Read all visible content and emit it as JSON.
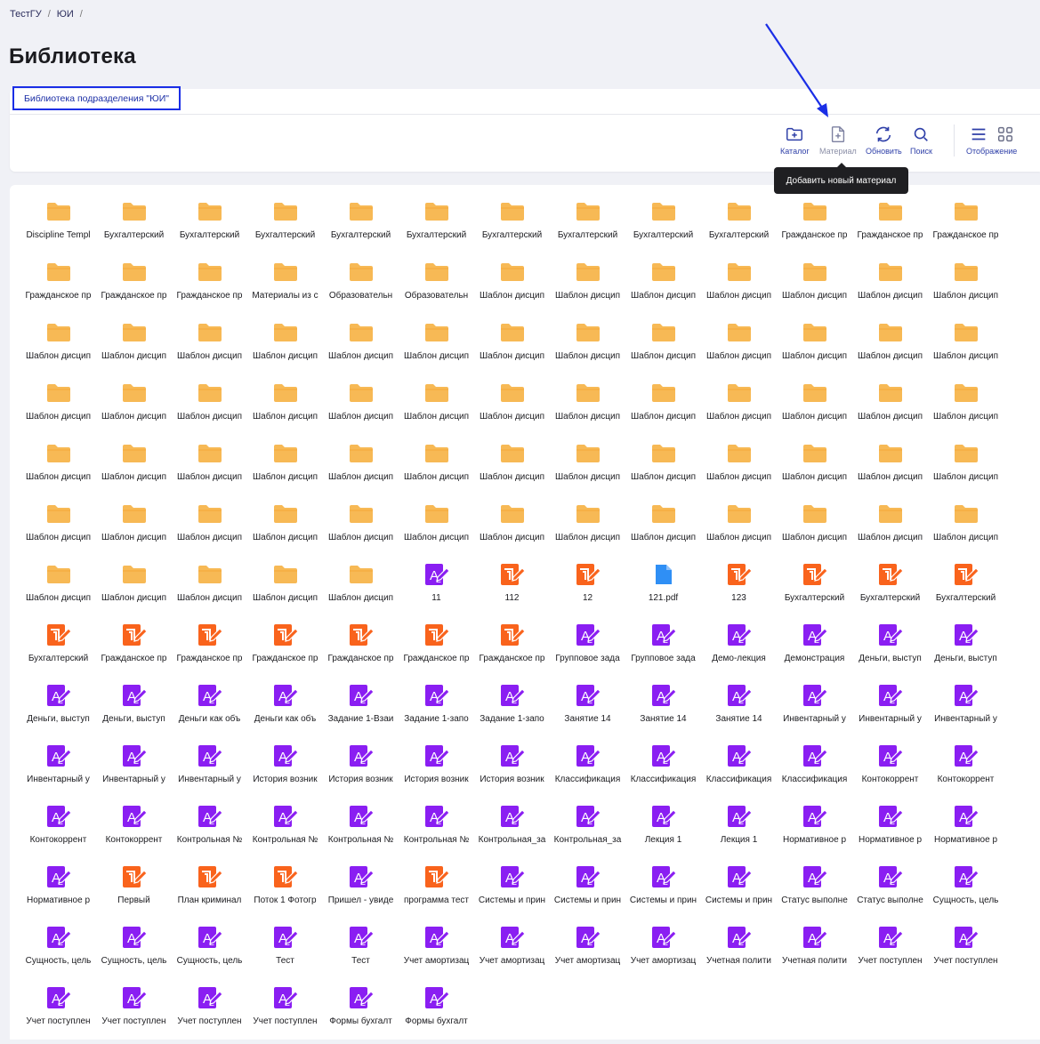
{
  "breadcrumbs": [
    "ТестГУ",
    "ЮИ"
  ],
  "page_title": "Библиотека",
  "tab": {
    "label": "Библиотека подразделения \"ЮИ\""
  },
  "toolbar": {
    "catalog": "Каталог",
    "material": "Материал",
    "refresh": "Обновить",
    "search": "Поиск",
    "view": "Отображение"
  },
  "tooltip": "Добавить новый материал",
  "colors": {
    "folder": "#f7b955",
    "edu": "#8a1ef2",
    "test": "#f9631c",
    "file": "#2f8ff5",
    "accent": "#2e3fa8",
    "annotation": "#1a2ee6"
  },
  "items": [
    {
      "type": "folder",
      "label": "Discipline Templ"
    },
    {
      "type": "folder",
      "label": "Бухгалтерский"
    },
    {
      "type": "folder",
      "label": "Бухгалтерский"
    },
    {
      "type": "folder",
      "label": "Бухгалтерский"
    },
    {
      "type": "folder",
      "label": "Бухгалтерский"
    },
    {
      "type": "folder",
      "label": "Бухгалтерский"
    },
    {
      "type": "folder",
      "label": "Бухгалтерский"
    },
    {
      "type": "folder",
      "label": "Бухгалтерский"
    },
    {
      "type": "folder",
      "label": "Бухгалтерский"
    },
    {
      "type": "folder",
      "label": "Бухгалтерский"
    },
    {
      "type": "folder",
      "label": "Гражданское пр"
    },
    {
      "type": "folder",
      "label": "Гражданское пр"
    },
    {
      "type": "folder",
      "label": "Гражданское пр"
    },
    {
      "type": "folder",
      "label": "Гражданское пр"
    },
    {
      "type": "folder",
      "label": "Гражданское пр"
    },
    {
      "type": "folder",
      "label": "Гражданское пр"
    },
    {
      "type": "folder",
      "label": "Материалы из с"
    },
    {
      "type": "folder",
      "label": "Образовательн"
    },
    {
      "type": "folder",
      "label": "Образовательн"
    },
    {
      "type": "folder",
      "label": "Шаблон дисцип"
    },
    {
      "type": "folder",
      "label": "Шаблон дисцип"
    },
    {
      "type": "folder",
      "label": "Шаблон дисцип"
    },
    {
      "type": "folder",
      "label": "Шаблон дисцип"
    },
    {
      "type": "folder",
      "label": "Шаблон дисцип"
    },
    {
      "type": "folder",
      "label": "Шаблон дисцип"
    },
    {
      "type": "folder",
      "label": "Шаблон дисцип"
    },
    {
      "type": "folder",
      "label": "Шаблон дисцип"
    },
    {
      "type": "folder",
      "label": "Шаблон дисцип"
    },
    {
      "type": "folder",
      "label": "Шаблон дисцип"
    },
    {
      "type": "folder",
      "label": "Шаблон дисцип"
    },
    {
      "type": "folder",
      "label": "Шаблон дисцип"
    },
    {
      "type": "folder",
      "label": "Шаблон дисцип"
    },
    {
      "type": "folder",
      "label": "Шаблон дисцип"
    },
    {
      "type": "folder",
      "label": "Шаблон дисцип"
    },
    {
      "type": "folder",
      "label": "Шаблон дисцип"
    },
    {
      "type": "folder",
      "label": "Шаблон дисцип"
    },
    {
      "type": "folder",
      "label": "Шаблон дисцип"
    },
    {
      "type": "folder",
      "label": "Шаблон дисцип"
    },
    {
      "type": "folder",
      "label": "Шаблон дисцип"
    },
    {
      "type": "folder",
      "label": "Шаблон дисцип"
    },
    {
      "type": "folder",
      "label": "Шаблон дисцип"
    },
    {
      "type": "folder",
      "label": "Шаблон дисцип"
    },
    {
      "type": "folder",
      "label": "Шаблон дисцип"
    },
    {
      "type": "folder",
      "label": "Шаблон дисцип"
    },
    {
      "type": "folder",
      "label": "Шаблон дисцип"
    },
    {
      "type": "folder",
      "label": "Шаблон дисцип"
    },
    {
      "type": "folder",
      "label": "Шаблон дисцип"
    },
    {
      "type": "folder",
      "label": "Шаблон дисцип"
    },
    {
      "type": "folder",
      "label": "Шаблон дисцип"
    },
    {
      "type": "folder",
      "label": "Шаблон дисцип"
    },
    {
      "type": "folder",
      "label": "Шаблон дисцип"
    },
    {
      "type": "folder",
      "label": "Шаблон дисцип"
    },
    {
      "type": "folder",
      "label": "Шаблон дисцип"
    },
    {
      "type": "folder",
      "label": "Шаблон дисцип"
    },
    {
      "type": "folder",
      "label": "Шаблон дисцип"
    },
    {
      "type": "folder",
      "label": "Шаблон дисцип"
    },
    {
      "type": "folder",
      "label": "Шаблон дисцип"
    },
    {
      "type": "folder",
      "label": "Шаблон дисцип"
    },
    {
      "type": "folder",
      "label": "Шаблон дисцип"
    },
    {
      "type": "folder",
      "label": "Шаблон дисцип"
    },
    {
      "type": "folder",
      "label": "Шаблон дисцип"
    },
    {
      "type": "folder",
      "label": "Шаблон дисцип"
    },
    {
      "type": "folder",
      "label": "Шаблон дисцип"
    },
    {
      "type": "folder",
      "label": "Шаблон дисцип"
    },
    {
      "type": "folder",
      "label": "Шаблон дисцип"
    },
    {
      "type": "folder",
      "label": "Шаблон дисцип"
    },
    {
      "type": "folder",
      "label": "Шаблон дисцип"
    },
    {
      "type": "folder",
      "label": "Шаблон дисцип"
    },
    {
      "type": "folder",
      "label": "Шаблон дисцип"
    },
    {
      "type": "folder",
      "label": "Шаблон дисцип"
    },
    {
      "type": "folder",
      "label": "Шаблон дисцип"
    },
    {
      "type": "folder",
      "label": "Шаблон дисцип"
    },
    {
      "type": "folder",
      "label": "Шаблон дисцип"
    },
    {
      "type": "folder",
      "label": "Шаблон дисцип"
    },
    {
      "type": "folder",
      "label": "Шаблон дисцип"
    },
    {
      "type": "folder",
      "label": "Шаблон дисцип"
    },
    {
      "type": "folder",
      "label": "Шаблон дисцип"
    },
    {
      "type": "folder",
      "label": "Шаблон дисцип"
    },
    {
      "type": "folder",
      "label": "Шаблон дисцип"
    },
    {
      "type": "folder",
      "label": "Шаблон дисцип"
    },
    {
      "type": "folder",
      "label": "Шаблон дисцип"
    },
    {
      "type": "folder",
      "label": "Шаблон дисцип"
    },
    {
      "type": "folder",
      "label": "Шаблон дисцип"
    },
    {
      "type": "edu",
      "label": "11"
    },
    {
      "type": "test",
      "label": "112"
    },
    {
      "type": "test",
      "label": "12"
    },
    {
      "type": "file",
      "label": "121.pdf"
    },
    {
      "type": "test",
      "label": "123"
    },
    {
      "type": "test",
      "label": "Бухгалтерский"
    },
    {
      "type": "test",
      "label": "Бухгалтерский"
    },
    {
      "type": "test",
      "label": "Бухгалтерский"
    },
    {
      "type": "test",
      "label": "Бухгалтерский"
    },
    {
      "type": "test",
      "label": "Гражданское пр"
    },
    {
      "type": "test",
      "label": "Гражданское пр"
    },
    {
      "type": "test",
      "label": "Гражданское пр"
    },
    {
      "type": "test",
      "label": "Гражданское пр"
    },
    {
      "type": "test",
      "label": "Гражданское пр"
    },
    {
      "type": "test",
      "label": "Гражданское пр"
    },
    {
      "type": "edu",
      "label": "Групповое зада"
    },
    {
      "type": "edu",
      "label": "Групповое зада"
    },
    {
      "type": "edu",
      "label": "Демо-лекция"
    },
    {
      "type": "edu",
      "label": "Демонстрация"
    },
    {
      "type": "edu",
      "label": "Деньги, выступ"
    },
    {
      "type": "edu",
      "label": "Деньги, выступ"
    },
    {
      "type": "edu",
      "label": "Деньги, выступ"
    },
    {
      "type": "edu",
      "label": "Деньги, выступ"
    },
    {
      "type": "edu",
      "label": "Деньги как объ"
    },
    {
      "type": "edu",
      "label": "Деньги как объ"
    },
    {
      "type": "edu",
      "label": "Задание 1-Взаи"
    },
    {
      "type": "edu",
      "label": "Задание 1-запо"
    },
    {
      "type": "edu",
      "label": "Задание 1-запо"
    },
    {
      "type": "edu",
      "label": "Занятие 14"
    },
    {
      "type": "edu",
      "label": "Занятие 14"
    },
    {
      "type": "edu",
      "label": "Занятие 14"
    },
    {
      "type": "edu",
      "label": "Инвентарный у"
    },
    {
      "type": "edu",
      "label": "Инвентарный у"
    },
    {
      "type": "edu",
      "label": "Инвентарный у"
    },
    {
      "type": "edu",
      "label": "Инвентарный у"
    },
    {
      "type": "edu",
      "label": "Инвентарный у"
    },
    {
      "type": "edu",
      "label": "Инвентарный у"
    },
    {
      "type": "edu",
      "label": "История возник"
    },
    {
      "type": "edu",
      "label": "История возник"
    },
    {
      "type": "edu",
      "label": "История возник"
    },
    {
      "type": "edu",
      "label": "История возник"
    },
    {
      "type": "edu",
      "label": "Классификация"
    },
    {
      "type": "edu",
      "label": "Классификация"
    },
    {
      "type": "edu",
      "label": "Классификация"
    },
    {
      "type": "edu",
      "label": "Классификация"
    },
    {
      "type": "edu",
      "label": "Контокоррент"
    },
    {
      "type": "edu",
      "label": "Контокоррент"
    },
    {
      "type": "edu",
      "label": "Контокоррент"
    },
    {
      "type": "edu",
      "label": "Контокоррент"
    },
    {
      "type": "edu",
      "label": "Контрольная №"
    },
    {
      "type": "edu",
      "label": "Контрольная №"
    },
    {
      "type": "edu",
      "label": "Контрольная №"
    },
    {
      "type": "edu",
      "label": "Контрольная №"
    },
    {
      "type": "edu",
      "label": "Контрольная_за"
    },
    {
      "type": "edu",
      "label": "Контрольная_за"
    },
    {
      "type": "edu",
      "label": "Лекция 1"
    },
    {
      "type": "edu",
      "label": "Лекция 1"
    },
    {
      "type": "edu",
      "label": "Нормативное р"
    },
    {
      "type": "edu",
      "label": "Нормативное р"
    },
    {
      "type": "edu",
      "label": "Нормативное р"
    },
    {
      "type": "edu",
      "label": "Нормативное р"
    },
    {
      "type": "test",
      "label": "Первый"
    },
    {
      "type": "test",
      "label": "План криминал"
    },
    {
      "type": "test",
      "label": "Поток 1 Фотогр"
    },
    {
      "type": "edu",
      "label": "Пришел - увиде"
    },
    {
      "type": "test",
      "label": "программа тест"
    },
    {
      "type": "edu",
      "label": "Системы и прин"
    },
    {
      "type": "edu",
      "label": "Системы и прин"
    },
    {
      "type": "edu",
      "label": "Системы и прин"
    },
    {
      "type": "edu",
      "label": "Системы и прин"
    },
    {
      "type": "edu",
      "label": "Статус выполне"
    },
    {
      "type": "edu",
      "label": "Статус выполне"
    },
    {
      "type": "edu",
      "label": "Сущность, цель"
    },
    {
      "type": "edu",
      "label": "Сущность, цель"
    },
    {
      "type": "edu",
      "label": "Сущность, цель"
    },
    {
      "type": "edu",
      "label": "Сущность, цель"
    },
    {
      "type": "edu",
      "label": "Тест"
    },
    {
      "type": "edu",
      "label": "Тест"
    },
    {
      "type": "edu",
      "label": "Учет амортизац"
    },
    {
      "type": "edu",
      "label": "Учет амортизац"
    },
    {
      "type": "edu",
      "label": "Учет амортизац"
    },
    {
      "type": "edu",
      "label": "Учет амортизац"
    },
    {
      "type": "edu",
      "label": "Учетная полити"
    },
    {
      "type": "edu",
      "label": "Учетная полити"
    },
    {
      "type": "edu",
      "label": "Учет поступлен"
    },
    {
      "type": "edu",
      "label": "Учет поступлен"
    },
    {
      "type": "edu",
      "label": "Учет поступлен"
    },
    {
      "type": "edu",
      "label": "Учет поступлен"
    },
    {
      "type": "edu",
      "label": "Учет поступлен"
    },
    {
      "type": "edu",
      "label": "Учет поступлен"
    },
    {
      "type": "edu",
      "label": "Формы бухгалт"
    },
    {
      "type": "edu",
      "label": "Формы бухгалт"
    }
  ]
}
